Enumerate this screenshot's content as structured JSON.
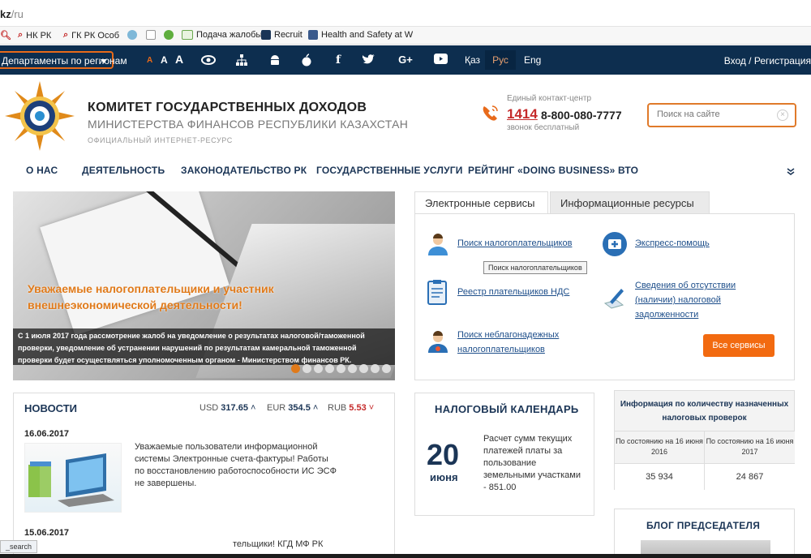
{
  "browser": {
    "url_prefix": "kz",
    "url_path": "/ru"
  },
  "bookmarks": [
    {
      "label": "НК РК",
      "icon": "search-icon"
    },
    {
      "label": "ГК РК Особ",
      "icon": "search-icon"
    },
    {
      "label": "",
      "icon": "globe-icon"
    },
    {
      "label": "",
      "icon": "page-icon"
    },
    {
      "label": "",
      "icon": "leaf-icon"
    },
    {
      "label": "Подача жалобы",
      "icon": "egov-icon"
    },
    {
      "label": "Recruit",
      "icon": "jh-icon"
    },
    {
      "label": "Health and Safety at W",
      "icon": "shield-icon"
    }
  ],
  "topbar": {
    "region_label": "Департаменты по регионам",
    "font_sizes": [
      "A",
      "A",
      "A"
    ],
    "langs": [
      "Қаз",
      "Рус",
      "Eng"
    ],
    "login": "Вход / Регистрация"
  },
  "header": {
    "title": "КОМИТЕТ ГОСУДАРСТВЕННЫХ ДОХОДОВ",
    "subtitle": "МИНИСТЕРСТВА ФИНАНСОВ РЕСПУБЛИКИ КАЗАХСТАН",
    "note": "ОФИЦИАЛЬНЫЙ ИНТЕРНЕТ-РЕСУРС",
    "contact_label": "Единый контакт-центр",
    "short_number": "1414",
    "long_number": "8-800-080-7777",
    "free_note": "звонок бесплатный",
    "search_placeholder": "Поиск на сайте"
  },
  "nav": [
    "О НАС",
    "ДЕЯТЕЛЬНОСТЬ",
    "ЗАКОНОДАТЕЛЬСТВО РК",
    "ГОСУДАРСТВЕННЫЕ УСЛУГИ",
    "РЕЙТИНГ «DOING BUSINESS»",
    "ВТО"
  ],
  "slider": {
    "headline": "Уважаемые налогоплательщики и участник внешнеэкономической деятельности!",
    "caption": "С 1 июля 2017 года рассмотрение жалоб на уведомление о результатах налоговой/таможенной проверки, уведомление об устранении нарушений по результатам камеральной таможенной проверки будет осуществляться уполномоченным органом - Министерством финансов РК.",
    "dots_total": 9,
    "dots_active": 1
  },
  "services": {
    "tabs": [
      "Электронные сервисы",
      "Информационные ресурсы"
    ],
    "items": [
      {
        "label": "Поиск налогоплательщиков",
        "icon": "user-search-icon"
      },
      {
        "label": "Экспресс-помощь",
        "icon": "first-aid-icon"
      },
      {
        "label": "Реестр плательщиков НДС",
        "icon": "clipboard-icon"
      },
      {
        "label": "Сведения об отсутствии (наличии) налоговой задолженности",
        "icon": "pen-document-icon"
      },
      {
        "label": "Поиск неблагонадежных налогоплательщиков",
        "icon": "user-alert-icon"
      }
    ],
    "tooltip": "Поиск налогоплательщиков",
    "all_button": "Все сервисы"
  },
  "news": {
    "title": "НОВОСТИ",
    "currencies": [
      {
        "code": "USD",
        "value": "317.65",
        "trend": "up"
      },
      {
        "code": "EUR",
        "value": "354.5",
        "trend": "up"
      },
      {
        "code": "RUB",
        "value": "5.53",
        "trend": "down"
      }
    ],
    "items": [
      {
        "date": "16.06.2017",
        "text": "Уважаемые пользователи информационной системы Электронные счета-фактуры! Работы по восстановлению работоспособности ИС ЭСФ не завершены."
      },
      {
        "date": "15.06.2017",
        "text": "тельщики! КГД МФ РК"
      }
    ]
  },
  "calendar": {
    "title": "НАЛОГОВЫЙ КАЛЕНДАРЬ",
    "day": "20",
    "month": "июня",
    "text": "Расчет сумм текущих платежей платы за пользование земельными участками - 851.00"
  },
  "inspections": {
    "title": "Информация по количеству назначенных налоговых проверок",
    "cols": [
      {
        "label": "По состоянию на 16 июня 2016",
        "value": "35 934"
      },
      {
        "label": "По состоянию на 16 июня 2017",
        "value": "24 867"
      }
    ]
  },
  "blog": {
    "title": "БЛОГ ПРЕДСЕДАТЕЛЯ"
  },
  "status_text": "_search",
  "colors": {
    "navy": "#0d2e4f",
    "accent": "#e86a1a",
    "link": "#1d4e8a",
    "button": "#f26a10"
  }
}
